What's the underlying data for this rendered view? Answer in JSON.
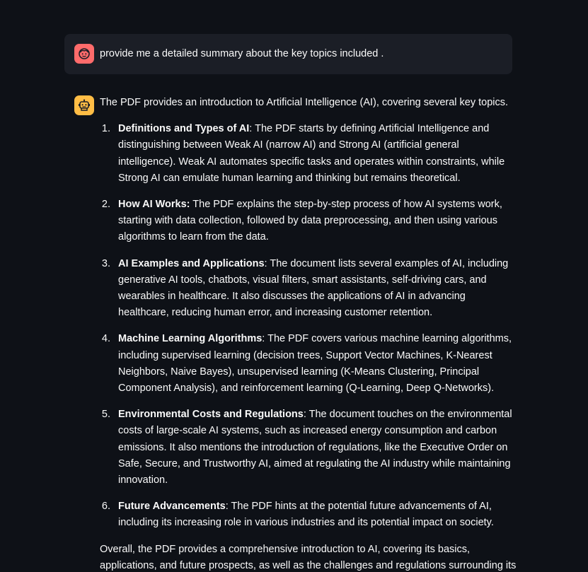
{
  "user_message": {
    "avatar_icon": "user-face-icon",
    "text": "provide me a detailed summary about the key topics included ."
  },
  "assistant_message": {
    "avatar_icon": "robot-icon",
    "intro": "The PDF provides an introduction to Artificial Intelligence (AI), covering several key topics.",
    "topics": [
      {
        "number": "1.",
        "heading": "Definitions and Types of AI",
        "text": ": The PDF starts by defining Artificial Intelligence and distinguishing between Weak AI (narrow AI) and Strong AI (artificial general intelligence). Weak AI automates specific tasks and operates within constraints, while Strong AI can emulate human learning and thinking but remains theoretical."
      },
      {
        "number": "2.",
        "heading": "How AI Works:",
        "text": " The PDF explains the step-by-step process of how AI systems work, starting with data collection, followed by data preprocessing, and then using various algorithms to learn from the data."
      },
      {
        "number": "3.",
        "heading": "AI Examples and Applications",
        "text": ": The document lists several examples of AI, including generative AI tools, chatbots, visual filters, smart assistants, self-driving cars, and wearables in healthcare. It also discusses the applications of AI in advancing healthcare, reducing human error, and increasing customer retention."
      },
      {
        "number": "4.",
        "heading": "Machine Learning Algorithms",
        "text": ": The PDF covers various machine learning algorithms, including supervised learning (decision trees, Support Vector Machines, K-Nearest Neighbors, Naive Bayes), unsupervised learning (K-Means Clustering, Principal Component Analysis), and reinforcement learning (Q-Learning, Deep Q-Networks)."
      },
      {
        "number": "5.",
        "heading": "Environmental Costs and Regulations",
        "text": ": The document touches on the environmental costs of large-scale AI systems, such as increased energy consumption and carbon emissions. It also mentions the introduction of regulations, like the Executive Order on Safe, Secure, and Trustworthy AI, aimed at regulating the AI industry while maintaining innovation."
      },
      {
        "number": "6.",
        "heading": "Future Advancements",
        "text": ": The PDF hints at the potential future advancements of AI, including its increasing role in various industries and its potential impact on society."
      }
    ],
    "outro": "Overall, the PDF provides a comprehensive introduction to AI, covering its basics, applications, and future prospects, as well as the challenges and regulations surrounding its development."
  },
  "colors": {
    "background": "#0e1117",
    "user_bubble": "#1b1e26",
    "user_avatar": "#ff6b6b",
    "assistant_avatar": "#ffbd45",
    "text": "#fafafa"
  }
}
